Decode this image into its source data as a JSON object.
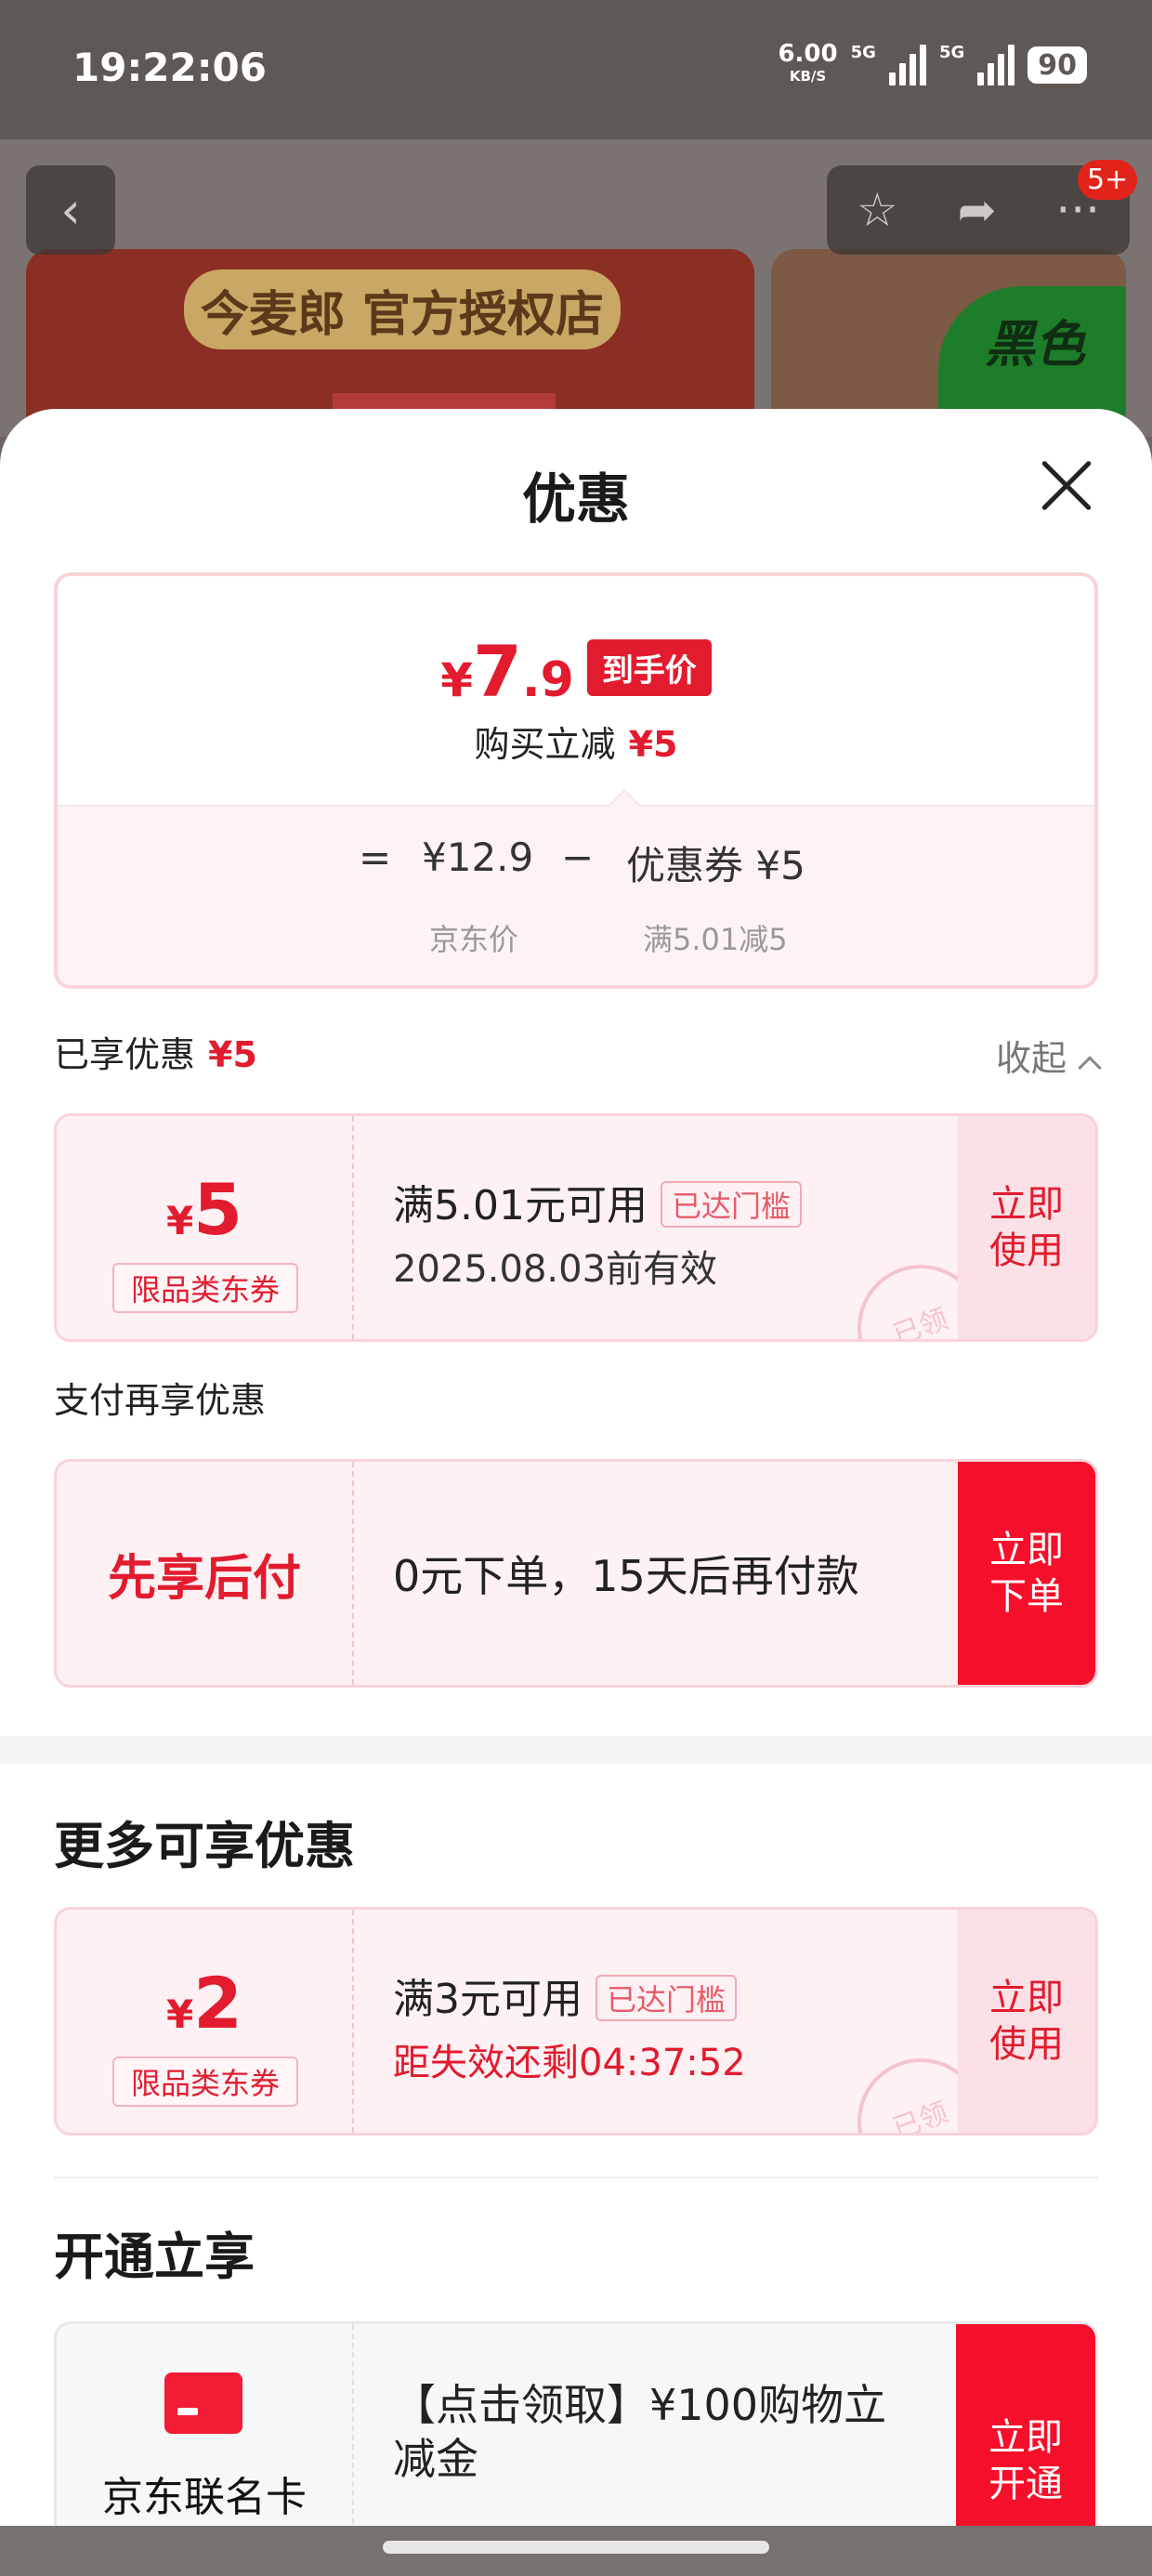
{
  "status_bar": {
    "time": "19:22:06",
    "speed": "6.00",
    "speed_unit": "KB/S",
    "net1": "5G",
    "net2": "5G",
    "battery": "90"
  },
  "background": {
    "store_banner": "今麦郎 官方授权店",
    "promo_text": "黑色",
    "badge": "5+"
  },
  "sheet": {
    "title": "优惠"
  },
  "price_box": {
    "currency": "¥",
    "price_int": "7",
    "price_dec": ".9",
    "price_tag": "到手价",
    "reduce_label": "购买立减",
    "reduce_value": "¥5",
    "eq": "=",
    "jd_price": "¥12.9",
    "minus": "−",
    "coupon_label": "优惠券 ¥5",
    "jd_price_label": "京东价",
    "coupon_cond": "满5.01减5"
  },
  "enjoyed": {
    "label": "已享优惠",
    "value": "¥5",
    "collapse": "收起"
  },
  "coupon1": {
    "currency": "¥",
    "amount": "5",
    "type": "限品类东券",
    "condition": "满5.01元可用",
    "flag": "已达门槛",
    "validity": "2025.08.03前有效",
    "button": "立即\n使用",
    "stamp": "已领"
  },
  "pay_section": {
    "label": "支付再享优惠",
    "left_text": "先享后付",
    "desc": "0元下单，15天后再付款",
    "button": "立即\n下单"
  },
  "more": {
    "label": "更多可享优惠"
  },
  "coupon2": {
    "currency": "¥",
    "amount": "2",
    "type": "限品类东券",
    "condition": "满3元可用",
    "flag": "已达门槛",
    "countdown": "距失效还剩04:37:52",
    "button": "立即\n使用",
    "stamp": "已领"
  },
  "open_section": {
    "label": "开通立享",
    "card_name": "京东联名卡",
    "desc": "【点击领取】¥100购物立减金",
    "button": "立即\n开通"
  },
  "colors": {
    "accent_red": "#e21b2f",
    "button_red": "#f50f2a",
    "coupon_bg": "#fdf1f3"
  }
}
